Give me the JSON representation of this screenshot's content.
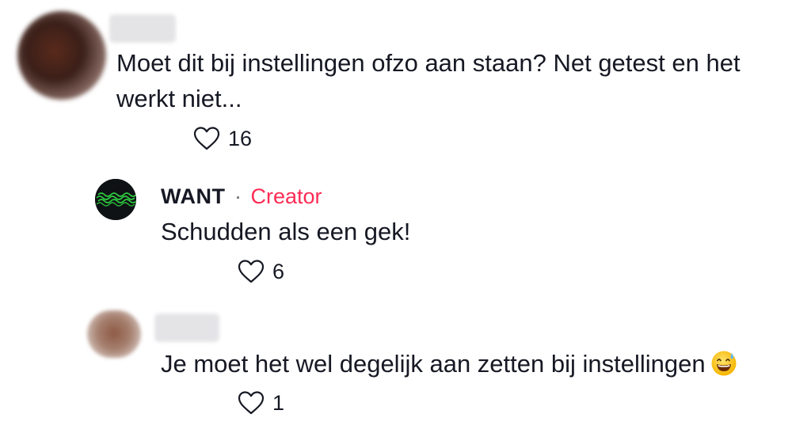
{
  "comments": [
    {
      "text_line1": "Moet dit bij instellingen ofzo aan staan? Net getest en het",
      "text_line2": "werkt niet...",
      "likes": "16",
      "avatar_icon": "blurred-avatar-icon"
    },
    {
      "author": "WANT",
      "separator": "·",
      "badge": "Creator",
      "text": "Schudden als een gek!",
      "likes": "6",
      "avatar_icon": "waveform-logo-icon"
    },
    {
      "text": "Je moet het wel degelijk aan zetten bij instellingen",
      "emoji": "grinning-face-with-sweat-icon",
      "likes": "1",
      "avatar_icon": "blurred-avatar-icon"
    }
  ],
  "colors": {
    "text": "#161823",
    "creator_badge": "#fe2c55",
    "muted": "#6c6d73",
    "heart_outline": "#161823",
    "logo_wave": "#2ecc40"
  }
}
